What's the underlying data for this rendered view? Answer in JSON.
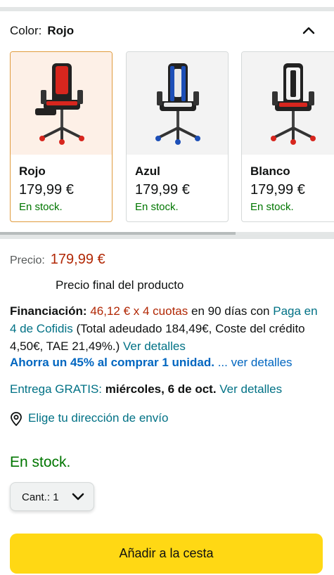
{
  "color": {
    "label": "Color:",
    "value": "Rojo"
  },
  "swatches": [
    {
      "name": "Rojo",
      "price": "179,99 €",
      "stock": "En stock.",
      "accent": "#d7261e"
    },
    {
      "name": "Azul",
      "price": "179,99 €",
      "stock": "En stock.",
      "accent": "#1d4fb7"
    },
    {
      "name": "Blanco",
      "price": "179,99 €",
      "stock": "En stock.",
      "accent": "#ffffff"
    }
  ],
  "price": {
    "label": "Precio:",
    "value": "179,99 €",
    "final": "Precio final del producto"
  },
  "financing": {
    "label": "Financiación:",
    "amount": "46,12 € x 4 cuotas",
    "days": "en 90 días con",
    "provider": "Paga en 4 de Cofidis",
    "terms": "(Total adeudado 184,49€, Coste del crédito 4,50€, TAE 21,49%.)",
    "details": "Ver detalles"
  },
  "savings": {
    "text": "Ahorra un 45% al comprar 1 unidad.",
    "details": "... ver detalles"
  },
  "delivery": {
    "label": "Entrega GRATIS:",
    "date": "miércoles, 6 de oct.",
    "details": "Ver detalles"
  },
  "address": {
    "label": "Elige tu dirección de envío"
  },
  "availability": "En stock.",
  "quantity": {
    "label": "Cant.:",
    "value": "1"
  },
  "cart_button": "Añadir a la cesta",
  "colors": {
    "price_red": "#b12704",
    "link": "#007185",
    "stock_green": "#007600",
    "cart_yellow": "#ffd814",
    "selected_border": "#e09b3d"
  }
}
